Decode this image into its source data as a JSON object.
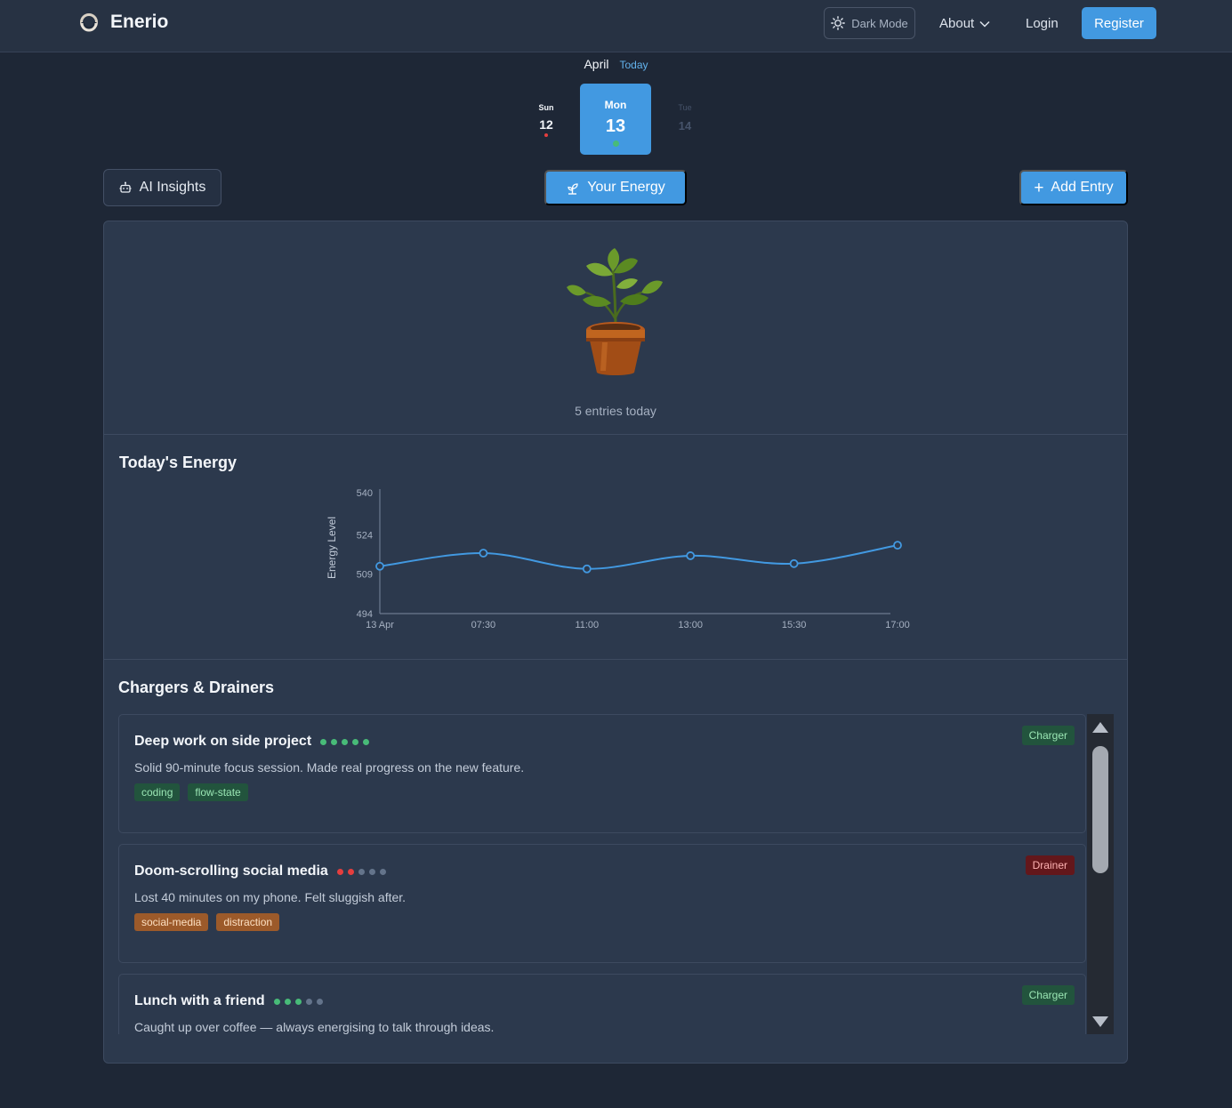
{
  "nav": {
    "brand": "Enerio",
    "theme_toggle": "Dark Mode",
    "about": "About",
    "login": "Login",
    "register": "Register"
  },
  "calendar": {
    "month": "April",
    "today_link": "Today",
    "days": [
      {
        "name": "Sun",
        "number": "12",
        "dot_color": "#e53e3e"
      },
      {
        "name": "Mon",
        "number": "13",
        "dot_color": "#48bb78",
        "selected": true
      },
      {
        "name": "Tue",
        "number": "14"
      }
    ]
  },
  "actions": {
    "ai_insights": "AI Insights",
    "your_energy": "Your Energy",
    "add_entry": "Add Entry",
    "add_entry_icon": "+"
  },
  "summary": {
    "entries_today": "5 entries today"
  },
  "energy_section": {
    "title": "Today's Energy"
  },
  "chart_data": {
    "type": "line",
    "title": "",
    "xlabel": "",
    "ylabel": "Energy Level",
    "x": [
      "13 Apr",
      "07:30",
      "11:00",
      "13:00",
      "15:30",
      "17:00"
    ],
    "series": [
      {
        "values": [
          512,
          517,
          511,
          516,
          513,
          520
        ]
      }
    ],
    "ylim": [
      494,
      540
    ],
    "yticks": [
      "540",
      "524",
      "509",
      "494"
    ],
    "grid": false,
    "line_color": "#4299e1"
  },
  "chargers_section": {
    "title": "Chargers & Drainers",
    "entries": [
      {
        "title": "Deep work on side project",
        "description": "Solid 90-minute focus session. Made real progress on the new feature.",
        "type": "Charger",
        "rating": 5,
        "rating_max": 5,
        "tags": [
          "coding",
          "flow-state"
        ]
      },
      {
        "title": "Doom-scrolling social media",
        "description": "Lost 40 minutes on my phone. Felt sluggish after.",
        "type": "Drainer",
        "rating": 2,
        "rating_max": 5,
        "tags": [
          "social-media",
          "distraction"
        ]
      },
      {
        "title": "Lunch with a friend",
        "description": "Caught up over coffee — always energising to talk through ideas.",
        "type": "Charger",
        "rating": 3,
        "rating_max": 5,
        "tags": []
      }
    ]
  },
  "colors": {
    "accent": "#4299e1",
    "charger": "#48bb78",
    "drainer": "#e53e3e",
    "inactive_dot": "#64748b"
  }
}
